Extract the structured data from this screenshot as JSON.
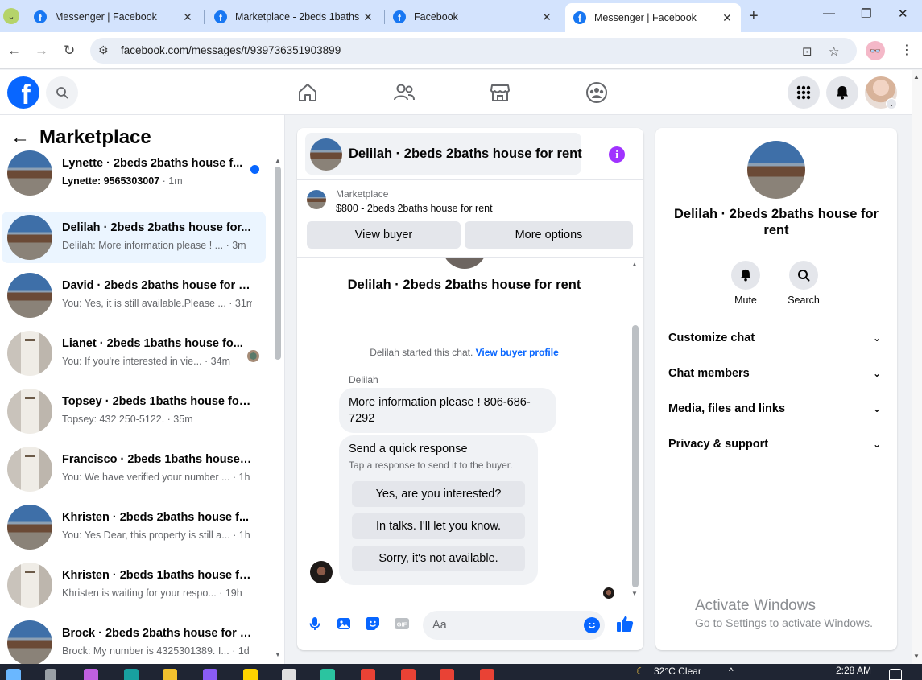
{
  "browser": {
    "tabs": [
      {
        "title": "Messenger | Facebook",
        "active": false
      },
      {
        "title": "Marketplace - 2beds 1baths",
        "active": false
      },
      {
        "title": "Facebook",
        "active": false
      },
      {
        "title": "Messenger | Facebook",
        "active": true
      }
    ],
    "url": "facebook.com/messages/t/939736351903899"
  },
  "sidebar": {
    "title": "Marketplace",
    "conversations": [
      {
        "name": "Lynette · 2beds 2baths house f...",
        "preview": "Lynette: 9565303007",
        "time": " · 1m",
        "image": "house",
        "unread": true,
        "selected": false
      },
      {
        "name": "Delilah · 2beds 2baths house for...",
        "preview": "Delilah: More information please ! ...",
        "time": " · 3m",
        "image": "house",
        "unread": false,
        "selected": true
      },
      {
        "name": "David · 2beds 2baths house for r...",
        "preview": "You: Yes, it is still available.Please ...",
        "time": " · 31m",
        "image": "house",
        "unread": false,
        "selected": false
      },
      {
        "name": "Lianet · 2beds 1baths house fo...",
        "preview": "You: If you're interested in vie...",
        "time": " · 34m",
        "image": "room",
        "unread": false,
        "selected": false
      },
      {
        "name": "Topsey · 2beds 1baths house for ...",
        "preview": "Topsey: 432 250-5122.",
        "time": " · 35m",
        "image": "room",
        "unread": false,
        "selected": false
      },
      {
        "name": "Francisco · 2beds 1baths house f...",
        "preview": "You: We have verified your number ...",
        "time": " · 1h",
        "image": "room",
        "unread": false,
        "selected": false
      },
      {
        "name": "Khristen · 2beds 2baths house f...",
        "preview": "You: Yes Dear, this property is still a...",
        "time": " · 1h",
        "image": "house",
        "unread": false,
        "selected": false
      },
      {
        "name": "Khristen · 2beds 1baths house fo...",
        "preview": "Khristen is waiting for your respo...",
        "time": " · 19h",
        "image": "room",
        "unread": false,
        "selected": false
      },
      {
        "name": "Brock · 2beds 2baths house for r...",
        "preview": "Brock: My number is 4325301389. I...",
        "time": " · 1d",
        "image": "house",
        "unread": false,
        "selected": false
      }
    ]
  },
  "chat": {
    "header_title": "Delilah · 2beds 2baths house for rent",
    "info_icon": "i",
    "marketplace_label": "Marketplace",
    "listing": "$800 - 2beds 2baths house for rent",
    "view_buyer_label": "View buyer",
    "more_options_label": "More options",
    "thread_title": "Delilah · 2beds 2baths house for rent",
    "started_text": "Delilah started this chat.",
    "view_profile_link": "View buyer profile",
    "sender": "Delilah",
    "message": "More information please ! 806-686-7292",
    "quick_title": "Send a quick response",
    "quick_subtitle": "Tap a response to send it to the buyer.",
    "quick_replies": [
      "Yes, are you interested?",
      "In talks. I'll let you know.",
      "Sorry, it's not available."
    ],
    "composer_placeholder": "Aa"
  },
  "details": {
    "name": "Delilah · 2beds 2baths house for rent",
    "mute_label": "Mute",
    "search_label": "Search",
    "sections": [
      "Customize chat",
      "Chat members",
      "Media, files and links",
      "Privacy & support"
    ]
  },
  "watermark": {
    "line1": "Activate Windows",
    "line2": "Go to Settings to activate Windows."
  },
  "taskbar": {
    "weather": "32°C  Clear",
    "time": "2:28 AM"
  },
  "colors": {
    "facebook_blue": "#0866ff",
    "selected_row": "#ebf5ff",
    "info_purple": "#a033ff"
  }
}
